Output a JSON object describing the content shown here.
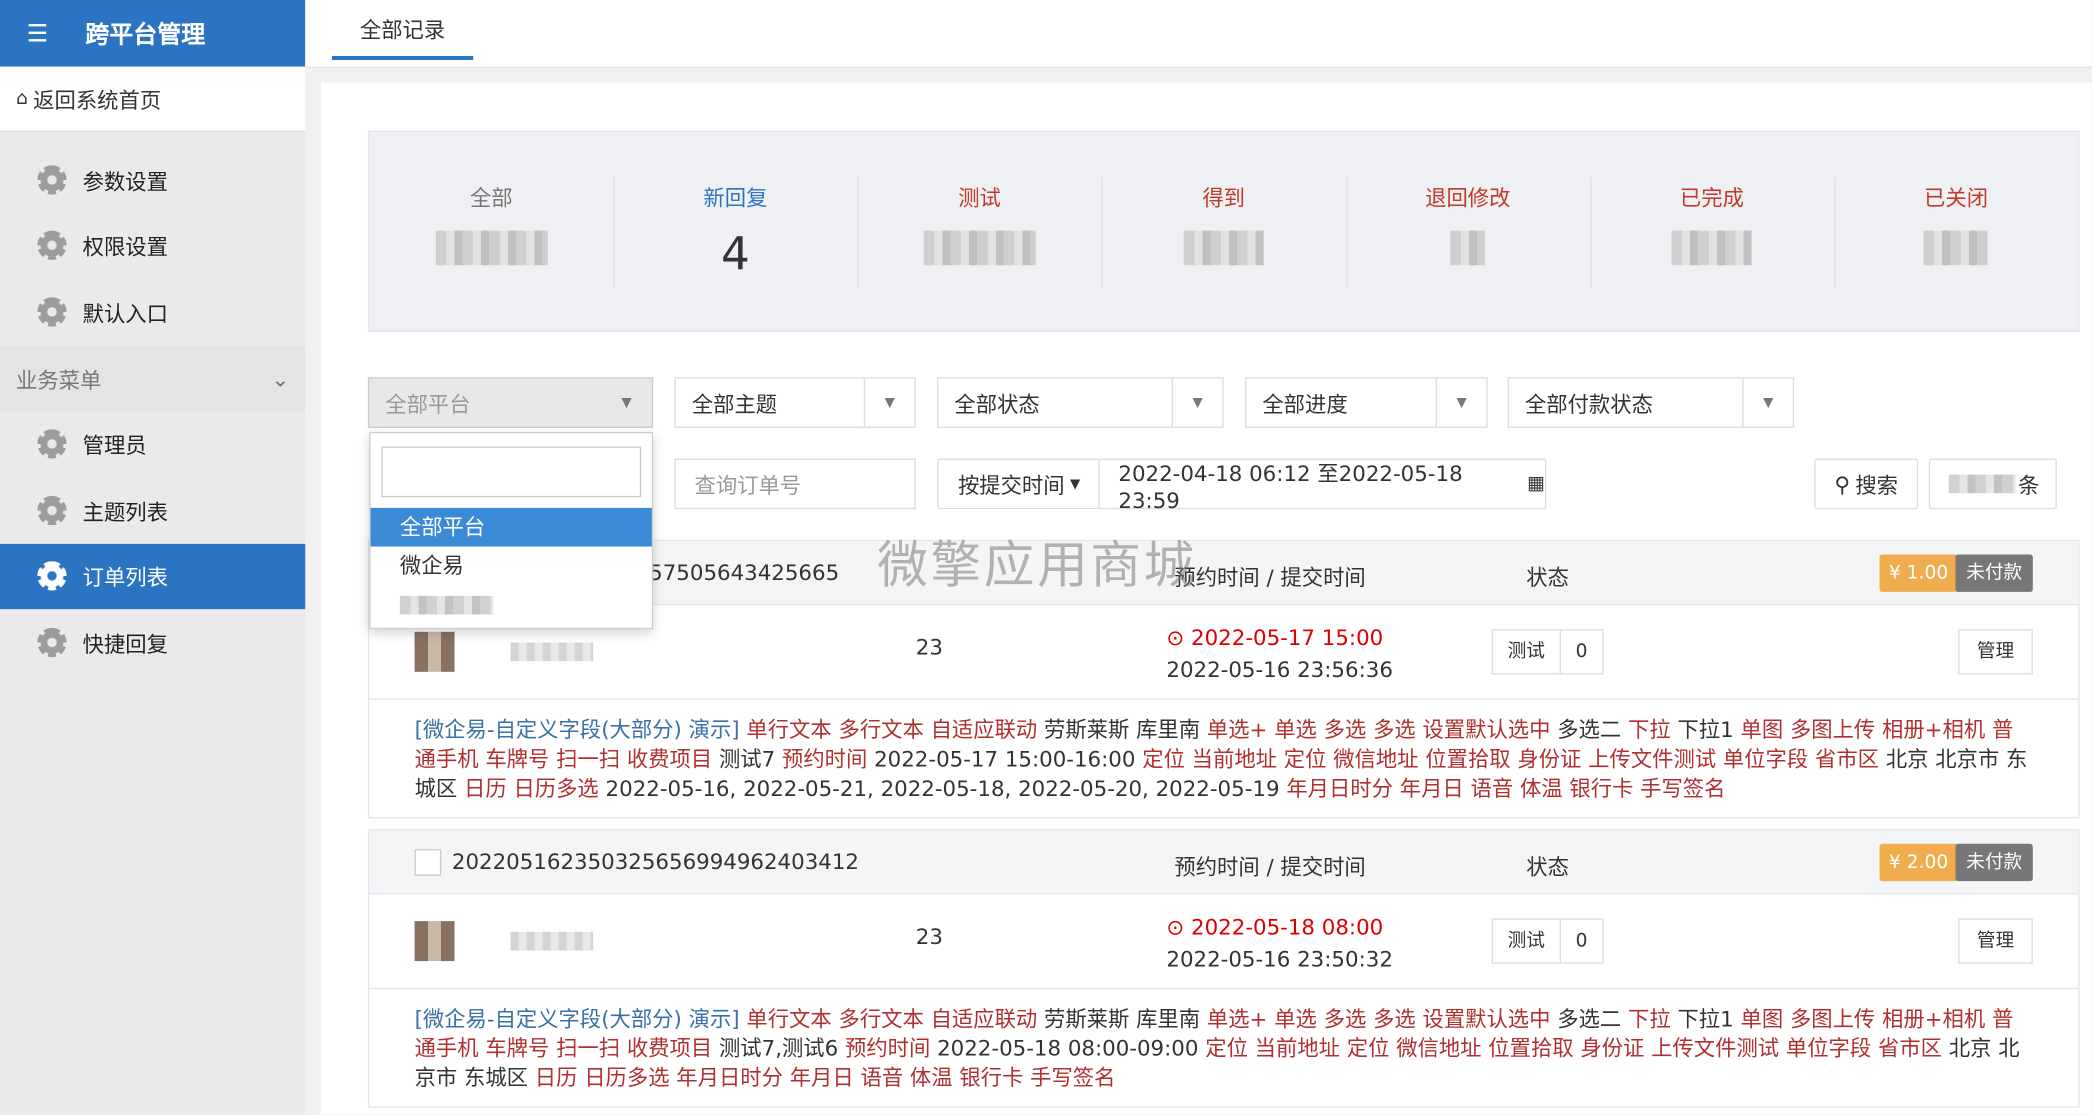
{
  "sidebar": {
    "brand": "跨平台管理",
    "home": "返回系统首页",
    "items_top": [
      "参数设置",
      "权限设置",
      "默认入口"
    ],
    "section": "业务菜单",
    "items_bottom": [
      "管理员",
      "主题列表",
      "订单列表",
      "快捷回复"
    ]
  },
  "topbar": {
    "tab": "全部记录"
  },
  "stats": {
    "labels": [
      "全部",
      "新回复",
      "测试",
      "得到",
      "退回修改",
      "已完成",
      "已关闭"
    ],
    "new_reply_value": "4",
    "label_colors": [
      "#777777",
      "#2b74c2",
      "#c0392b",
      "#c0392b",
      "#c0392b",
      "#c0392b",
      "#c0392b"
    ]
  },
  "filters": {
    "platform": "全部平台",
    "topic": "全部主题",
    "status": "全部状态",
    "progress": "全部进度",
    "payment": "全部付款状态",
    "order_placeholder": "查询订单号",
    "time_type": "按提交时间",
    "date_range": "2022-04-18 06:12 至2022-05-18 23:59",
    "search": "搜索",
    "count_suffix": "条",
    "platform_options": [
      "全部平台",
      "微企易"
    ]
  },
  "orders": [
    {
      "number": "57505643425665",
      "time_header": "预约时间 / 提交时间",
      "status_header": "状态",
      "price": "¥ 1.00",
      "pay_state": "未付款",
      "count": "23",
      "appoint": "2022-05-17 15:00",
      "submit": "2022-05-16 23:56:36",
      "tag": "测试",
      "tag_num": "0",
      "manage": "管理",
      "desc_link": "[微企易-自定义字段(大部分) 演示]",
      "desc": [
        {
          "t": "单行文本 多行文本 自适应联动 ",
          "c": "r"
        },
        {
          "t": "劳斯莱斯 库里南 ",
          "c": "k"
        },
        {
          "t": "单选+ 单选 多选 多选 设置默认选中 ",
          "c": "r"
        },
        {
          "t": "多选二 ",
          "c": "k"
        },
        {
          "t": "下拉 ",
          "c": "r"
        },
        {
          "t": "下拉1 ",
          "c": "k"
        },
        {
          "t": "单图 多图上传 相册+相机 普通手机 车牌号 扫一扫 收费项目 ",
          "c": "r"
        },
        {
          "t": "测试7 ",
          "c": "k"
        },
        {
          "t": "预约时间 ",
          "c": "r"
        },
        {
          "t": "2022-05-17 15:00-16:00 ",
          "c": "k"
        },
        {
          "t": "定位 当前地址 定位 微信地址 位置拾取 身份证 上传文件测试 单位字段 省市区 ",
          "c": "r"
        },
        {
          "t": "北京 北京市 东城区 ",
          "c": "k"
        },
        {
          "t": "日历 日历多选 ",
          "c": "r"
        },
        {
          "t": "2022-05-16, 2022-05-21, 2022-05-18, 2022-05-20, 2022-05-19 ",
          "c": "k"
        },
        {
          "t": "年月日时分 年月日 语音 体温 银行卡 手写签名",
          "c": "r"
        }
      ]
    },
    {
      "number": "2022051623503256569949624034​12",
      "time_header": "预约时间 / 提交时间",
      "status_header": "状态",
      "price": "¥ 2.00",
      "pay_state": "未付款",
      "count": "23",
      "appoint": "2022-05-18 08:00",
      "submit": "2022-05-16 23:50:32",
      "tag": "测试",
      "tag_num": "0",
      "manage": "管理",
      "desc_link": "[微企易-自定义字段(大部分) 演示]",
      "desc": [
        {
          "t": "单行文本 多行文本 自适应联动 ",
          "c": "r"
        },
        {
          "t": "劳斯莱斯 库里南 ",
          "c": "k"
        },
        {
          "t": "单选+ 单选 多选 多选 设置默认选中 ",
          "c": "r"
        },
        {
          "t": "多选二 ",
          "c": "k"
        },
        {
          "t": "下拉 ",
          "c": "r"
        },
        {
          "t": "下拉1 ",
          "c": "k"
        },
        {
          "t": "单图 多图上传 相册+相机 普通手机 车牌号 扫一扫 收费项目 ",
          "c": "r"
        },
        {
          "t": "测试7,测试6 ",
          "c": "k"
        },
        {
          "t": "预约时间 ",
          "c": "r"
        },
        {
          "t": "2022-05-18 08:00-09:00 ",
          "c": "k"
        },
        {
          "t": "定位 当前地址 定位 微信地址 位置拾取 身份证 上传文件测试 单位字段 省市区 ",
          "c": "r"
        },
        {
          "t": "北京 北京市 东城区 ",
          "c": "k"
        },
        {
          "t": "日历 日历多选 年月日时分 年月日 语音 体温 银行卡 手写签名",
          "c": "r"
        }
      ]
    }
  ],
  "watermark": "微擎应用商城"
}
